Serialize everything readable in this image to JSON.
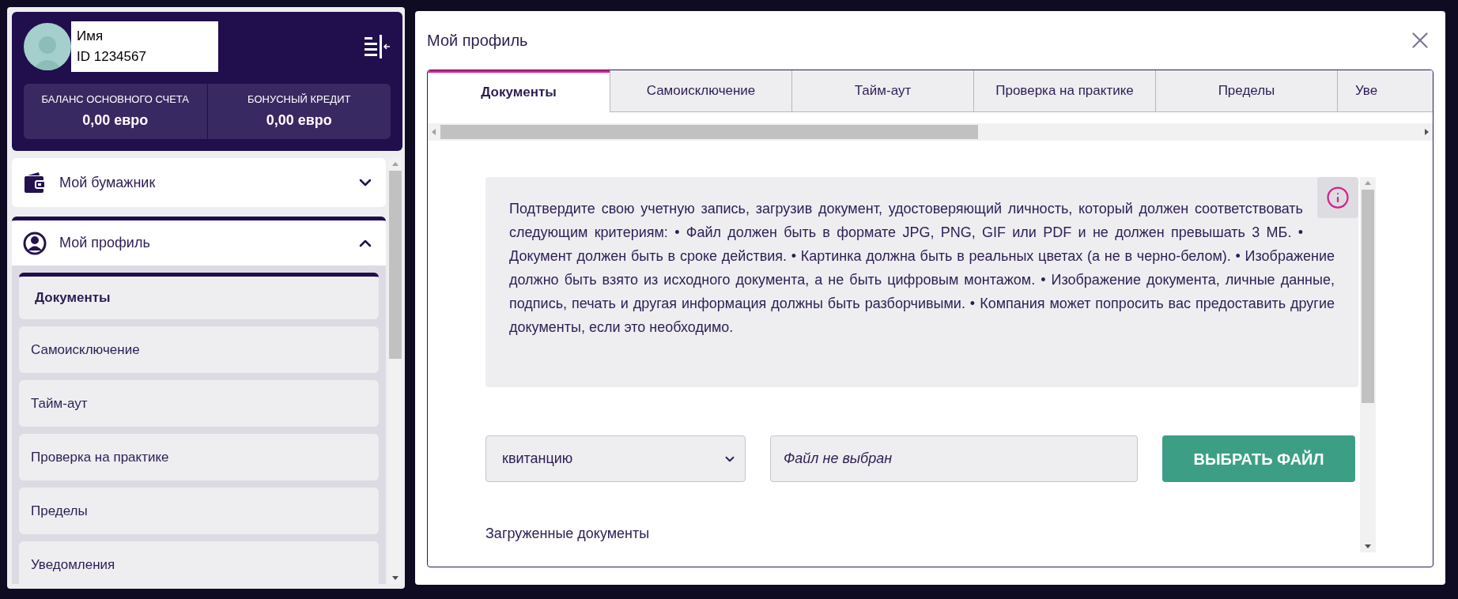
{
  "user": {
    "name": "Имя",
    "id": "ID 1234567"
  },
  "balances": [
    {
      "label": "БАЛАНС ОСНОВНОГО СЧЕТА",
      "value": "0,00 евро"
    },
    {
      "label": "БОНУСНЫЙ КРЕДИТ",
      "value": "0,00 евро"
    }
  ],
  "menu": [
    {
      "kind": "wallet",
      "label": "Мой бумажник",
      "expanded": false
    },
    {
      "kind": "profile",
      "label": "Мой профиль",
      "expanded": true,
      "children": [
        {
          "label": "Документы",
          "selected": true
        },
        {
          "label": "Самоисключение",
          "selected": false
        },
        {
          "label": "Тайм-аут",
          "selected": false
        },
        {
          "label": "Проверка на практике",
          "selected": false
        },
        {
          "label": "Пределы",
          "selected": false
        },
        {
          "label": "Уведомления",
          "selected": false
        }
      ]
    }
  ],
  "dialog": {
    "title": "Мой профиль",
    "tabs": [
      {
        "label": "Документы",
        "selected": true
      },
      {
        "label": "Самоисключение",
        "selected": false
      },
      {
        "label": "Тайм-аут",
        "selected": false
      },
      {
        "label": "Проверка на практике",
        "selected": false
      },
      {
        "label": "Пределы",
        "selected": false
      },
      {
        "label": "Уве",
        "selected": false
      }
    ],
    "info": "Подтвердите свою учетную запись, загрузив документ, удостоверяющий личность, который должен соответствовать следующим критериям: • Файл должен быть в формате JPG, PNG, GIF или PDF и не должен превышать 3 МБ. • Документ должен быть в сроке действия. • Картинка должна быть в реальных цветах (а не в черно-белом). • Изображение должно быть взято из исходного документа, а не быть цифровым монтажом. • Изображение документа, личные данные, подпись, печать и другая информация должны быть разборчивыми. • Компания может попросить вас предоставить другие документы, если это необходимо.",
    "document_type": "квитанцию",
    "file_field": {
      "value": "Файл не выбран"
    },
    "choose_button": "ВЫБРАТЬ ФАЙЛ",
    "uploaded_heading": "Загруженные документы"
  }
}
